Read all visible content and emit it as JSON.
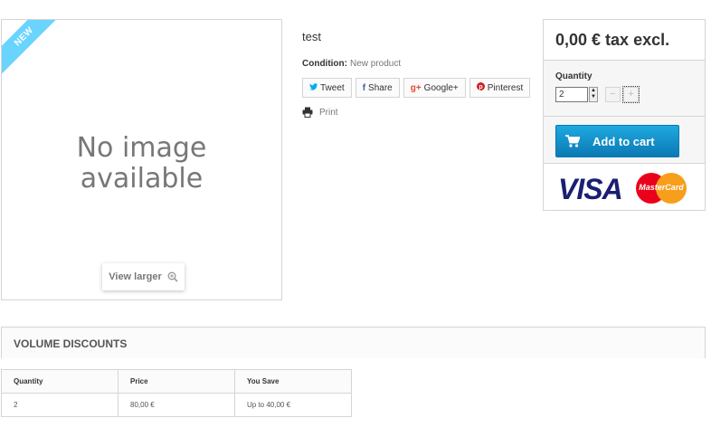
{
  "image": {
    "ribbon": "New",
    "no_image_line1": "No image",
    "no_image_line2": "available",
    "view_larger": "View larger"
  },
  "product": {
    "title": "test",
    "condition_label": "Condition:",
    "condition_value": "New product",
    "print_label": "Print"
  },
  "social": [
    {
      "icon": "twitter-icon",
      "glyph": "🐦",
      "label": "Tweet",
      "color": "#00aced"
    },
    {
      "icon": "facebook-icon",
      "glyph": "f",
      "label": "Share",
      "color": "#435f9f"
    },
    {
      "icon": "google-plus-icon",
      "glyph": "g+",
      "label": "Google+",
      "color": "#e04b34"
    },
    {
      "icon": "pinterest-icon",
      "glyph": "P",
      "label": "Pinterest",
      "color": "#ce1f21"
    }
  ],
  "buy": {
    "price": "0,00 € tax excl.",
    "quantity_label": "Quantity",
    "quantity_value": "2",
    "minus": "−",
    "plus": "+",
    "add_to_cart": "Add to cart",
    "accent": "#1ea9e0",
    "visa_label": "VISA",
    "mastercard_label": "MasterCard"
  },
  "volume_discounts": {
    "title": "Volume discounts",
    "headers": [
      "Quantity",
      "Price",
      "You Save"
    ],
    "rows": [
      [
        "2",
        "80,00 €",
        "Up to 40,00 €"
      ]
    ]
  }
}
